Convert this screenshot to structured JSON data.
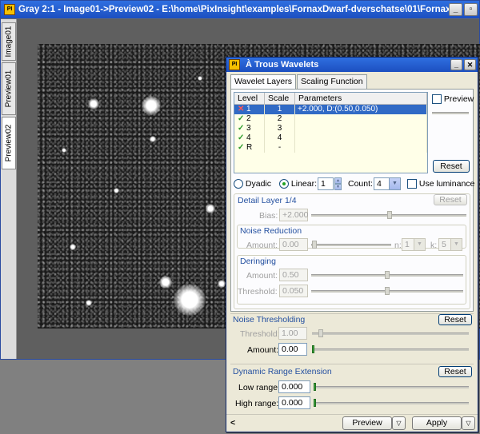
{
  "image_window": {
    "title": "Gray 2:1 - Image01->Preview02 - E:\\home\\PixInsight\\examples\\FornaxDwarf-dverschatse\\01\\FornaxDwar...",
    "icon": "pixinsight-app-icon",
    "min_glyph": "_",
    "max_glyph": "▫",
    "tabs": [
      "Image01",
      "Preview01",
      "Preview02"
    ],
    "active_tab": "Preview02"
  },
  "dialog": {
    "title": "À Trous Wavelets",
    "icon": "pixinsight-app-icon",
    "tabs": [
      "Wavelet Layers",
      "Scaling Function"
    ],
    "active_tab": "Wavelet Layers",
    "table": {
      "headers": [
        "Level",
        "Scale",
        "Parameters"
      ],
      "rows": [
        {
          "mark": "✕",
          "level": "1",
          "scale": "1",
          "params": "+2.000, D:(0.50,0.050)",
          "selected": true
        },
        {
          "mark": "✓",
          "level": "2",
          "scale": "2",
          "params": ""
        },
        {
          "mark": "✓",
          "level": "3",
          "scale": "3",
          "params": ""
        },
        {
          "mark": "✓",
          "level": "4",
          "scale": "4",
          "params": ""
        },
        {
          "mark": "✓",
          "level": "R",
          "scale": "-",
          "params": ""
        }
      ]
    },
    "preview_label": "Preview",
    "reset_label": "Reset",
    "dyadic_label": "Dyadic",
    "linear_label": "Linear:",
    "linear_value": "1",
    "count_label": "Count:",
    "count_value": "4",
    "use_luminance_label": "Use luminance",
    "detail_layer": {
      "title": "Detail Layer 1/4",
      "reset_label": "Reset",
      "bias_label": "Bias:",
      "bias_value": "+2.000",
      "noise_reduction_title": "Noise Reduction",
      "amount_label": "Amount:",
      "amount_value": "0.00",
      "n_label": "n:",
      "n_value": "1",
      "k_label": "k:",
      "k_value": "5",
      "deringing_title": "Deringing",
      "dr_amount_label": "Amount:",
      "dr_amount_value": "0.50",
      "threshold_label": "Threshold:",
      "threshold_value": "0.050"
    },
    "noise_thresholding": {
      "title": "Noise Thresholding",
      "reset_label": "Reset",
      "threshold_label": "Threshold:",
      "threshold_value": "1.00",
      "amount_label": "Amount:",
      "amount_value": "0.00"
    },
    "dre": {
      "title": "Dynamic Range Extension",
      "reset_label": "Reset",
      "low_label": "Low range:",
      "low_value": "0.000",
      "high_label": "High range:",
      "high_value": "0.000"
    },
    "bottom": {
      "preview_label": "Preview",
      "apply_label": "Apply",
      "collapse_glyph": "<"
    }
  }
}
